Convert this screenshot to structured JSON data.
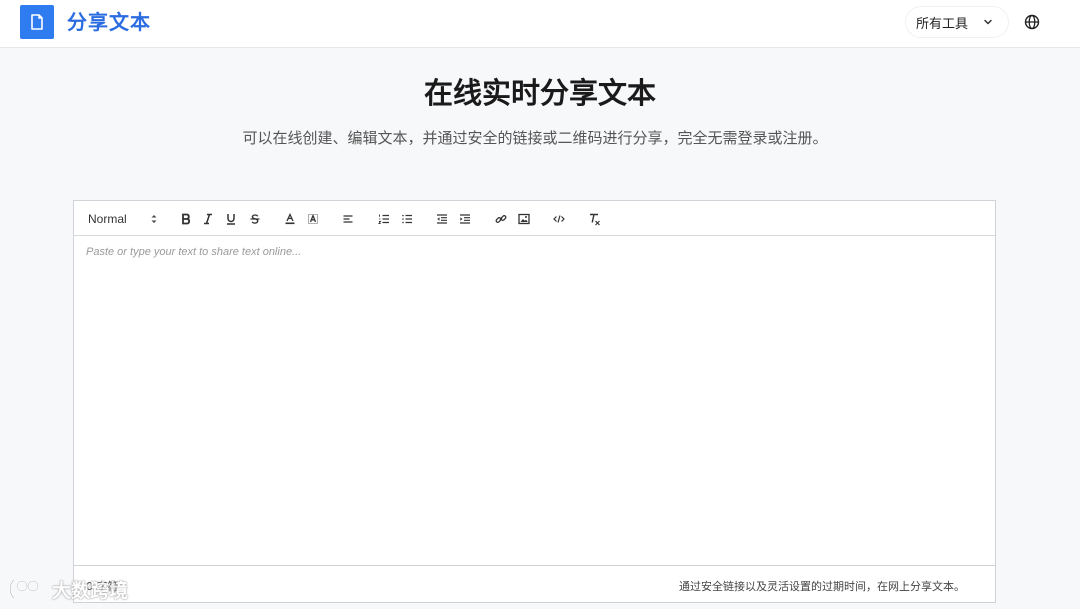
{
  "header": {
    "app_title": "分享文本",
    "tools_label": "所有工具",
    "logo_icon": "document-icon",
    "language_icon": "globe-icon"
  },
  "hero": {
    "title": "在线实时分享文本",
    "subtitle": "可以在线创建、编辑文本，并通过安全的链接或二维码进行分享，完全无需登录或注册。"
  },
  "editor": {
    "format_select": "Normal",
    "toolbar_icons": [
      "bold-icon",
      "italic-icon",
      "underline-icon",
      "strikethrough-icon",
      "text-color-icon",
      "background-color-icon",
      "align-icon",
      "ordered-list-icon",
      "bullet-list-icon",
      "outdent-icon",
      "indent-icon",
      "link-icon",
      "image-icon",
      "code-icon",
      "clear-format-icon"
    ],
    "placeholder": "Paste or type your text to share text online...",
    "char_count": "0 字符",
    "footer_note": "通过安全链接以及灵活设置的过期时间，在网上分享文本。"
  },
  "watermark": {
    "text": "大数跨境"
  },
  "colors": {
    "brand": "#2f7bf0",
    "title_blue": "#2b6de0",
    "background": "#f7f8fa"
  }
}
